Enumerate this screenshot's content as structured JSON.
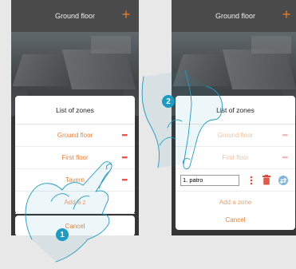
{
  "left_screen": {
    "header_title": "Ground floor",
    "plus_label": "+",
    "sheet_title": "List of zones",
    "zones": [
      {
        "label": "Ground floor",
        "menu": "•••"
      },
      {
        "label": "First floor",
        "menu": "•••"
      },
      {
        "label": "Tavern",
        "menu": "•••"
      }
    ],
    "add_zone_label": "Add a z",
    "cancel_label": "Cancel"
  },
  "right_screen": {
    "header_title": "Ground floor",
    "plus_label": "+",
    "sheet_title": "List of zones",
    "zones": [
      {
        "label": "Ground floor",
        "menu": "•••"
      },
      {
        "label": "First floor",
        "menu": "•••"
      }
    ],
    "edit_value": "1. patro",
    "add_zone_label": "Add a zone",
    "cancel_label": "Cancel"
  },
  "steps": {
    "step1": "1",
    "step2": "2"
  },
  "colors": {
    "accent": "#e8843c",
    "menu_dots": "#e74c3c",
    "badge": "#1a9cc4"
  },
  "icons": [
    "drag-handle-icon",
    "trash-icon",
    "swap-icon",
    "hand-pointer-icon"
  ]
}
